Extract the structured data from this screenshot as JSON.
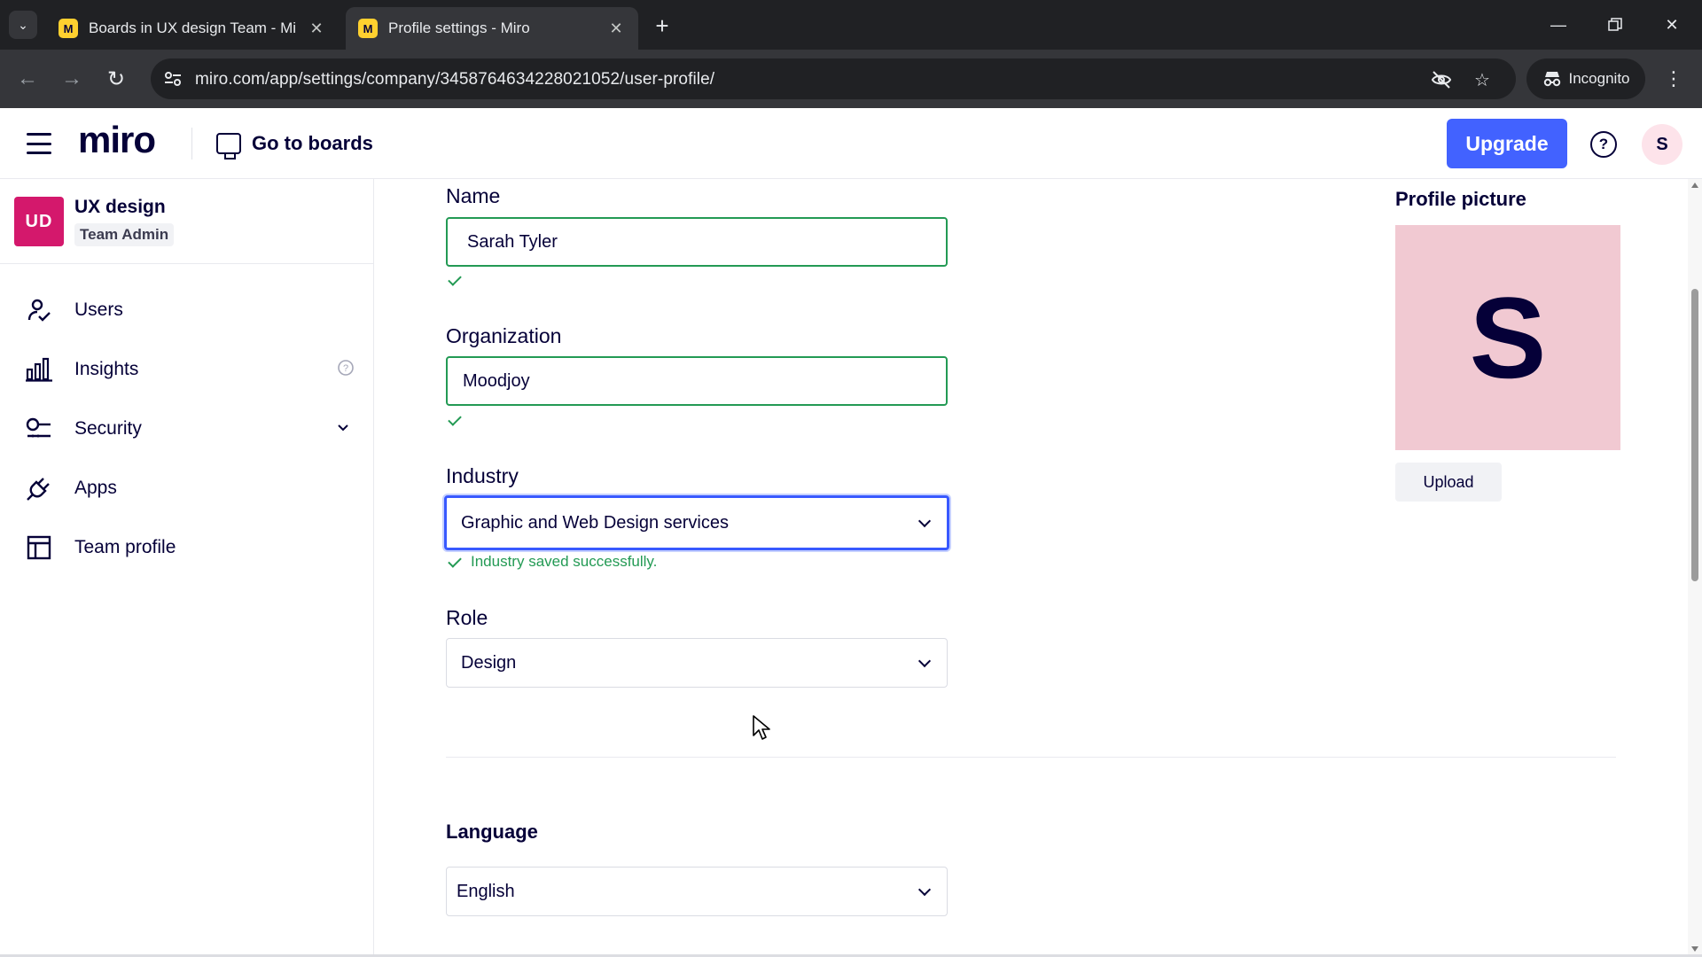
{
  "browser": {
    "tabs": [
      {
        "title": "Boards in UX design Team - Mi",
        "active": false
      },
      {
        "title": "Profile settings - Miro",
        "active": true
      }
    ],
    "url": "miro.com/app/settings/company/3458764634228021052/user-profile/",
    "incognito_label": "Incognito",
    "favicon_glyph": "M"
  },
  "header": {
    "logo": "miro",
    "go_to_boards": "Go to boards",
    "upgrade": "Upgrade",
    "help_glyph": "?",
    "avatar_initial": "S"
  },
  "sidebar": {
    "team": {
      "initials": "UD",
      "name": "UX design",
      "role": "Team Admin"
    },
    "items": [
      {
        "label": "Users",
        "icon": "user-check-icon"
      },
      {
        "label": "Insights",
        "icon": "bar-chart-icon",
        "extra": "info-icon"
      },
      {
        "label": "Security",
        "icon": "key-icon",
        "extra": "chevron-down-icon"
      },
      {
        "label": "Apps",
        "icon": "plug-icon"
      },
      {
        "label": "Team profile",
        "icon": "layout-icon"
      }
    ]
  },
  "form": {
    "name": {
      "label": "Name",
      "value": "Sarah Tyler"
    },
    "organization": {
      "label": "Organization",
      "value": "Moodjoy"
    },
    "industry": {
      "label": "Industry",
      "value": "Graphic and Web Design services",
      "message": "Industry saved successfully."
    },
    "role": {
      "label": "Role",
      "value": "Design"
    },
    "language": {
      "label": "Language",
      "value": "English"
    }
  },
  "profile_picture": {
    "label": "Profile picture",
    "initial": "S",
    "upload": "Upload"
  },
  "colors": {
    "accent": "#4262ff",
    "team_badge": "#d4186c",
    "success": "#239a54",
    "profile_bg": "#f1c9d2"
  }
}
